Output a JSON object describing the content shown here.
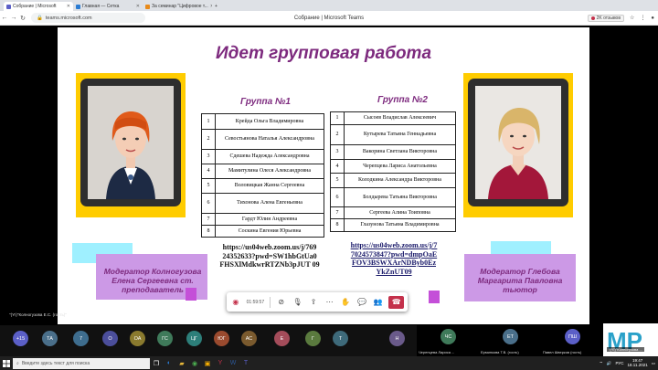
{
  "browser": {
    "tabs": [
      {
        "label": "Собрание | Microsoft",
        "color": "#5b5fc7",
        "active": true
      },
      {
        "label": "Главная — Сетка",
        "color": "#2b7cd3",
        "active": false
      },
      {
        "label": "За семинар \"Цифровое т...",
        "color": "#e88a1a",
        "active": false
      }
    ],
    "url": "teams.microsoft.com",
    "window_title": "Собрание | Microsoft Teams",
    "weather": "2K отзывов",
    "rec_label": "2K отзывов"
  },
  "slide": {
    "title": "Идет групповая работа",
    "group1": {
      "title": "Группа №1",
      "rows": [
        {
          "n": "1",
          "name": "Крейда Ольга Владимировна"
        },
        {
          "n": "2",
          "name": "Севостьянова Наталья Александровна"
        },
        {
          "n": "3",
          "name": "Сдешева Надежда Александровна"
        },
        {
          "n": "4",
          "name": "Мамитулина Олеся Александровна"
        },
        {
          "n": "5",
          "name": "Воловицкая Жанна Сергеевна"
        },
        {
          "n": "6",
          "name": "Тихонова Алена Евгеньевна"
        },
        {
          "n": "7",
          "name": "Гардт Юлия Андреевна"
        },
        {
          "n": "8",
          "name": "Соскина Евгения Юрьевна"
        }
      ],
      "link": "https://us04web.zoom.us/j/769 24352633?pwd=SW1hbGtUa0 FHSXlMdkwrRTZNb3pJUT 09",
      "moderator": "Модератор Колногузова Елена Сергеевна ст. преподаватель"
    },
    "group2": {
      "title": "Группа №2",
      "rows": [
        {
          "n": "1",
          "name": "Сысоев Владислав Алексеевич"
        },
        {
          "n": "2",
          "name": "Кутырева Татьяна Геннадьевна"
        },
        {
          "n": "3",
          "name": "Вакорина Светлана Викторовна"
        },
        {
          "n": "4",
          "name": "Черепцева Лариса Анатольевна"
        },
        {
          "n": "5",
          "name": "Колодкина Александра Викторовна"
        },
        {
          "n": "6",
          "name": "Болдырева Татьяна Викторовна"
        },
        {
          "n": "7",
          "name": "Сергеева Алина Тоиповна"
        },
        {
          "n": "8",
          "name": "Глазунова  Татьяна Владимировна"
        }
      ],
      "link": "https://us04web.zoom.us/j/7 7024573847?pwd=dmpOaE FOV3BSWXArNDByb0Ez YkZnUT09",
      "moderator": "Модератор Глебова Маргарита Павловна тьютор"
    }
  },
  "owner_label": "\"(YI)\"Колногузова Е.С. (гость)\"",
  "controls": {
    "timer": "01:59:57"
  },
  "participants": [
    {
      "initials": "+15",
      "color": "#5b5fc7"
    },
    {
      "initials": "ТА",
      "color": "#4a6f8a"
    },
    {
      "initials": "7",
      "color": "#3e6d8e"
    },
    {
      "initials": "О",
      "color": "#4b4e9b"
    },
    {
      "initials": "ОА",
      "color": "#8a7a2e"
    },
    {
      "initials": "ГС",
      "color": "#3f7a5a"
    },
    {
      "initials": "ЦГ",
      "color": "#2d7f7a"
    },
    {
      "initials": "ЮГ",
      "color": "#9a4a2e"
    },
    {
      "initials": "АС",
      "color": "#7a5a2e"
    },
    {
      "initials": "Е",
      "color": "#a44c5a"
    },
    {
      "initials": "Г",
      "color": "#5a7a3e"
    },
    {
      "initials": "Т",
      "color": "#3e6a7a"
    },
    {
      "initials": "Н",
      "color": "#6a5a8a"
    }
  ],
  "video_tiles": [
    {
      "initials": "ЧС",
      "name": "Черенцева Лариса ...",
      "color": "#3f7a5a"
    },
    {
      "initials": "ЕТ",
      "name": "Ерминкова Т.В. (гость)",
      "color": "#4a6f8a"
    },
    {
      "initials": "ПШ",
      "name": "Павел Шверков (гость)",
      "color": "#5b5fc7"
    }
  ],
  "self_tile_name": "\"(YI)\"Колногузова ...",
  "logo_text": "MP",
  "taskbar": {
    "search_placeholder": "Введите здесь текст для поиска",
    "time": "19:47",
    "date": "18.11.2021",
    "lang": "РУС"
  }
}
